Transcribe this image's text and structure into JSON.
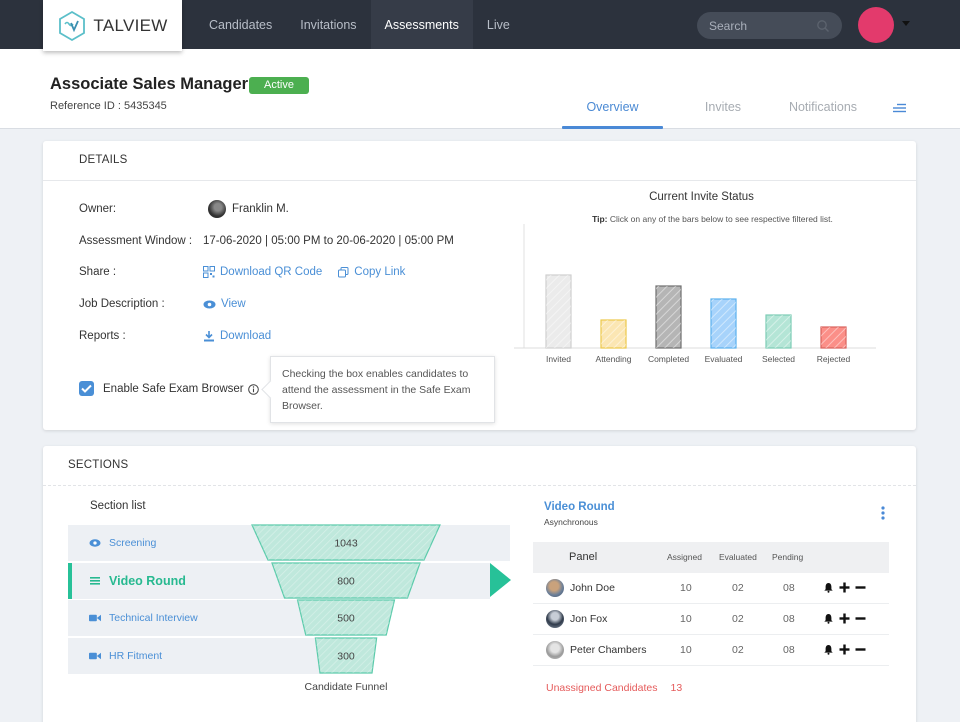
{
  "app": {
    "logo_text": "TALVIEW",
    "nav": [
      {
        "label": "Candidates",
        "active": false
      },
      {
        "label": "Invitations",
        "active": false
      },
      {
        "label": "Assessments",
        "active": true
      },
      {
        "label": "Live",
        "active": false
      }
    ],
    "search_placeholder": "Search",
    "icons": {
      "search": "search-icon",
      "avatar": "user-avatar",
      "menu": "caret-down-icon"
    },
    "colors": {
      "topbar": "#2c323d",
      "accent": "#4a89d6",
      "teal": "#27c198",
      "avatar": "#e33a6c",
      "active_badge": "#4caf50",
      "danger": "#e55b5b"
    }
  },
  "header": {
    "title": "Associate Sales Manager",
    "status_badge": "Active",
    "reference_label": "Reference ID : 5435345",
    "tabs": [
      {
        "label": "Overview",
        "active": true
      },
      {
        "label": "Invites",
        "active": false
      },
      {
        "label": "Notifications",
        "active": false
      }
    ],
    "more_icon": "hamburger-icon"
  },
  "details": {
    "heading": "DETAILS",
    "owner_label": "Owner:",
    "owner_name": "Franklin M.",
    "window_label": "Assessment Window :",
    "window_value": "17-06-2020 | 05:00 PM to 20-06-2020 | 05:00 PM",
    "share_label": "Share :",
    "share_qr": "Download QR Code",
    "share_copy": "Copy Link",
    "jd_label": "Job Description :",
    "jd_view": "View",
    "reports_label": "Reports :",
    "reports_download": "Download",
    "seb_label": "Enable Safe Exam Browser",
    "seb_checked": true,
    "seb_tooltip": "Checking the box enables candidates to attend the assessment in the Safe Exam Browser."
  },
  "chart_data": {
    "type": "bar",
    "title": "Current Invite Status",
    "tip_bold": "Tip:",
    "tip_text": " Click on any of the bars below to see respective filtered list.",
    "categories": [
      "Invited",
      "Attending",
      "Completed",
      "Evaluated",
      "Selected",
      "Rejected"
    ],
    "values": [
      73,
      28,
      62,
      49,
      33,
      21
    ],
    "value_note": "relative heights; no axis scale shown",
    "colors": [
      {
        "fill": "#ebebeb",
        "stroke": "#cfcfcf"
      },
      {
        "fill": "#fbe6b3",
        "stroke": "#ecc94b"
      },
      {
        "fill": "#b5b5b5",
        "stroke": "#6f6f6f"
      },
      {
        "fill": "#a7d3fb",
        "stroke": "#5bb1ee"
      },
      {
        "fill": "#b4e5d6",
        "stroke": "#7ccbb4"
      },
      {
        "fill": "#fb8f88",
        "stroke": "#d9625c"
      }
    ],
    "xlabel": "",
    "ylabel": "",
    "grid": false,
    "legend": "none"
  },
  "sections": {
    "heading": "SECTIONS",
    "list_title": "Section list",
    "items": [
      {
        "label": "Screening",
        "icon": "eye-icon",
        "count": 1043,
        "active": false
      },
      {
        "label": "Video Round",
        "icon": "list-icon",
        "count": 800,
        "active": true
      },
      {
        "label": "Technical Interview",
        "icon": "video-camera-icon",
        "count": 500,
        "active": false
      },
      {
        "label": "HR Fitment",
        "icon": "video-camera-icon",
        "count": 300,
        "active": false
      }
    ],
    "funnel_caption": "Candidate Funnel"
  },
  "selected_section": {
    "title": "Video Round",
    "subtitle": "Asynchronous",
    "columns": [
      "Panel",
      "Assigned",
      "Evaluated",
      "Pending"
    ],
    "rows": [
      {
        "name": "John Doe",
        "assigned": "10",
        "evaluated": "02",
        "pending": "08"
      },
      {
        "name": "Jon Fox",
        "assigned": "10",
        "evaluated": "02",
        "pending": "08"
      },
      {
        "name": "Peter Chambers",
        "assigned": "10",
        "evaluated": "02",
        "pending": "08"
      }
    ],
    "unassigned_label": "Unassigned Candidates",
    "unassigned_count": "13"
  }
}
